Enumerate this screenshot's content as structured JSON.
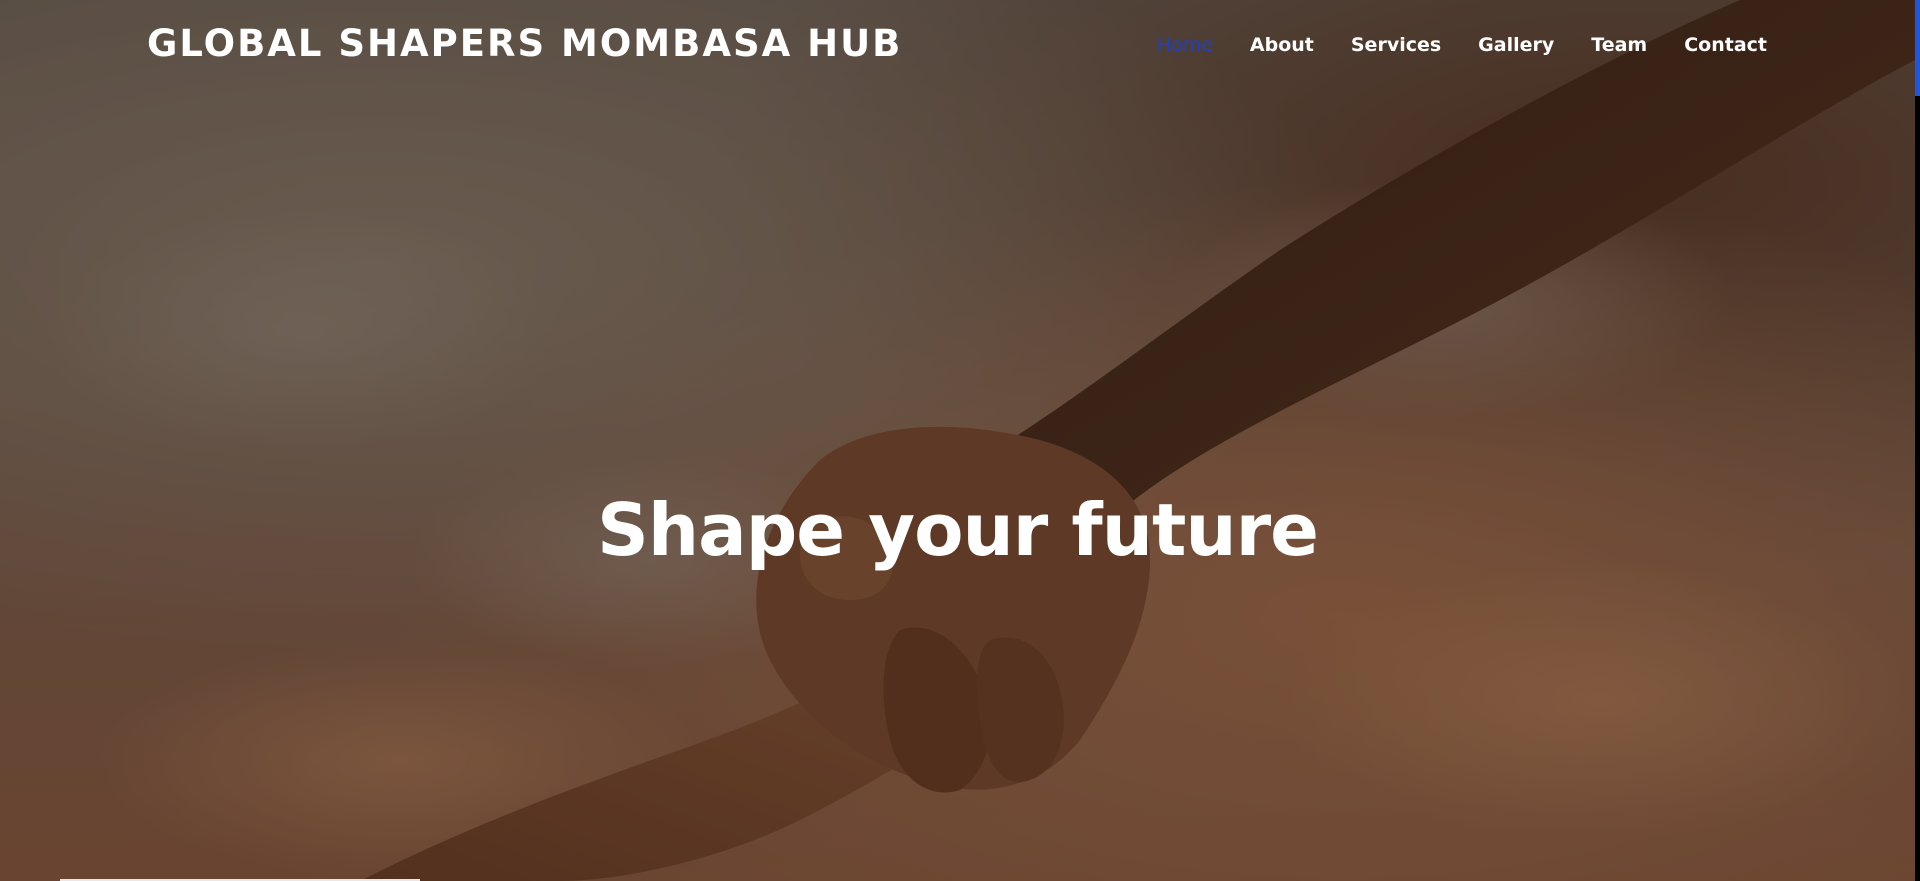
{
  "site": {
    "brand": "GLOBAL SHAPERS MOMBASA HUB"
  },
  "nav": {
    "items": [
      {
        "label": "Home",
        "active": true
      },
      {
        "label": "About",
        "active": false
      },
      {
        "label": "Services",
        "active": false
      },
      {
        "label": "Gallery",
        "active": false
      },
      {
        "label": "Team",
        "active": false
      },
      {
        "label": "Contact",
        "active": false
      }
    ]
  },
  "hero": {
    "title": "Shape your future",
    "background": "handshake-photo"
  },
  "colors": {
    "accent": "#1e40c8",
    "text": "#ffffff",
    "scroll_thumb": "#1e56e0"
  }
}
